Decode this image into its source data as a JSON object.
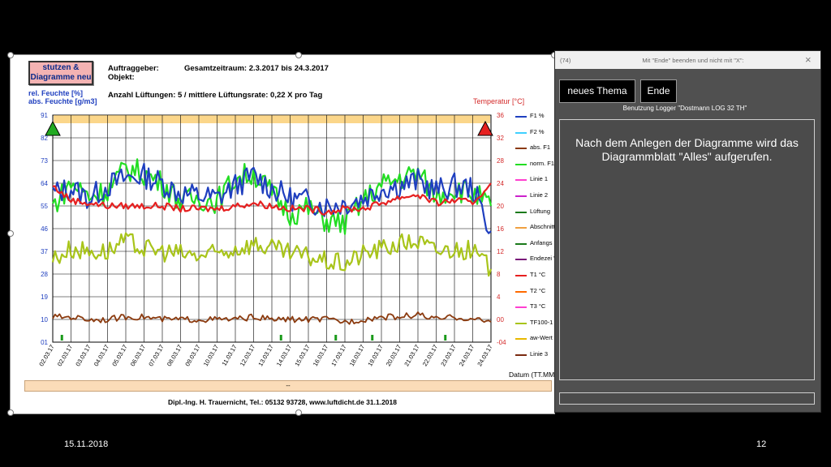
{
  "sheet": {
    "button_line1": "stutzen &",
    "button_line2": "Diagramme neu",
    "auftraggeber": "Auftraggeber:",
    "gesamtzeitraum": "Gesamtzeitraum: 2.3.2017 bis 24.3.2017",
    "objekt": "Objekt:",
    "lueftungen": "Anzahl Lüftungen: 5 / mittlere Lüftungsrate: 0,22 X pro Tag",
    "ylabel_left_1": "rel. Feuchte [%]",
    "ylabel_left_2": "abs. Feuchte [g/m3]",
    "ylabel_right": "Temperatur [°C]",
    "xlabel": "Datum (TT.MM",
    "bar_text": "--",
    "footer": "Dipl.-Ing. H. Trauernicht, Tel.: 05132 93728, www.luftdicht.de 31.1.2018"
  },
  "chart_data": {
    "type": "line",
    "title": "",
    "xlabel": "Datum (TT.MM",
    "ylabel": "rel. Feuchte [%] / abs. Feuchte [g/m3]",
    "y2label": "Temperatur [°C]",
    "y_ticks": [
      "91",
      "82",
      "73",
      "64",
      "55",
      "46",
      "37",
      "28",
      "19",
      "10",
      "01"
    ],
    "y2_ticks": [
      "36",
      "32",
      "28",
      "24",
      "20",
      "16",
      "12",
      "8",
      "4",
      "00",
      "-04"
    ],
    "ylim": [
      1,
      91
    ],
    "y2lim": [
      -4,
      36
    ],
    "categories": [
      "02.03.17",
      "02.03.17",
      "03.03.17",
      "04.03.17",
      "05.03.17",
      "06.03.17",
      "07.03.17",
      "08.03.17",
      "09.03.17",
      "10.03.17",
      "11.03.17",
      "12.03.17",
      "13.03.17",
      "14.03.17",
      "15.03.17",
      "16.03.17",
      "17.03.17",
      "18.03.17",
      "19.03.17",
      "20.03.17",
      "21.03.17",
      "22.03.17",
      "23.03.17",
      "24.03.17",
      "24.03.17"
    ],
    "series": [
      {
        "name": "F1 %",
        "color": "#1f3fbf",
        "axis": "left",
        "values": [
          60,
          62,
          58,
          63,
          66,
          67,
          64,
          60,
          59,
          58,
          63,
          67,
          62,
          58,
          57,
          55,
          56,
          58,
          62,
          63,
          65,
          61,
          63,
          62,
          45
        ]
      },
      {
        "name": "norm. F1",
        "color": "#22dd22",
        "axis": "left",
        "values": [
          55,
          64,
          59,
          61,
          70,
          68,
          64,
          57,
          58,
          57,
          66,
          68,
          60,
          52,
          54,
          49,
          48,
          57,
          63,
          66,
          68,
          59,
          62,
          60,
          55
        ]
      },
      {
        "name": "T1 °C",
        "color": "#e62020",
        "axis": "right",
        "values": [
          23.5,
          21,
          20.5,
          20,
          20,
          20,
          20,
          19.5,
          19.5,
          19.5,
          20,
          20.5,
          20,
          19.5,
          19.5,
          19,
          19.5,
          19.5,
          20.5,
          21.5,
          22,
          20.5,
          21,
          20.5,
          24
        ]
      },
      {
        "name": "TF100-1",
        "color": "#a8c41a",
        "axis": "left",
        "values": [
          34,
          38,
          37,
          37,
          41,
          38,
          37,
          36,
          35,
          36,
          38,
          40,
          38,
          36,
          35,
          33,
          32,
          36,
          38,
          40,
          41,
          37,
          38,
          37,
          30
        ]
      },
      {
        "name": "abs. F1",
        "color": "#8b3a0e",
        "axis": "left",
        "values": [
          11,
          11,
          10,
          10,
          11,
          11,
          10,
          10,
          10,
          10,
          10,
          11,
          10,
          10,
          10,
          10,
          9,
          10,
          11,
          11,
          12,
          10,
          11,
          10,
          9
        ]
      }
    ],
    "legend": [
      "F1 %",
      "F2 %",
      "abs. F1",
      "norm. F1",
      "Linie 1",
      "Linie 2",
      "Lüftung",
      "Abschnitt",
      "Anfangs \"Daten s",
      "Endezei \"Daten s",
      "T1 °C",
      "T2 °C",
      "T3 °C",
      "TF100-1",
      "aw-Wert",
      "Linie 3"
    ],
    "legend_colors": [
      "#1f3fbf",
      "#3fd0ff",
      "#8b3a0e",
      "#22dd22",
      "#ff3fd0",
      "#cc22cc",
      "#1a7a1a",
      "#f0a040",
      "#1a7a1a",
      "#7a1a7a",
      "#e62020",
      "#ff6a00",
      "#ff3fd0",
      "#a8c41a",
      "#e8b800",
      "#7a2a10"
    ],
    "grid": true,
    "legend_position": "right"
  },
  "dialog": {
    "title_left": "(74)",
    "title_center": "Mit \"Ende\" beenden und nicht mit \"X\":",
    "close_glyph": "×",
    "btn_new": "neues Thema",
    "btn_end": "Ende",
    "subtitle": "Benutzung Logger \"Dostmann LOG 32 TH\"",
    "message": "Nach dem Anlegen der Diagramme wird das Diagrammblatt \"Alles\" aufgerufen."
  },
  "slide": {
    "date": "15.11.2018",
    "number": "12"
  }
}
